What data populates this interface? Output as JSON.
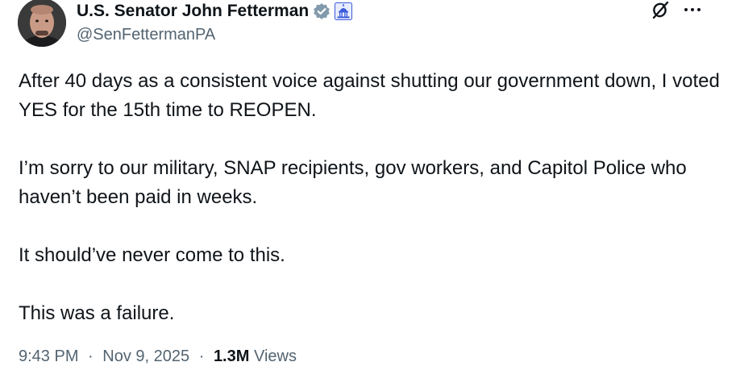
{
  "author": {
    "display_name": "U.S. Senator John Fetterman",
    "handle": "@SenFettermanPA",
    "verified_badge_icon": "verified-badge-icon",
    "government_badge_icon": "capitol-building-icon",
    "badge_color": "#829aab"
  },
  "actions": {
    "grok_icon": "grok-icon",
    "more_icon": "more-options-icon"
  },
  "tweet": {
    "paragraphs": [
      "After 40 days as a consistent voice against shutting our government down, I voted YES for the 15th time to REOPEN.",
      "I’m sorry to our military, SNAP recipients, gov workers, and Capitol Police who haven’t been paid in weeks.",
      "It should’ve never come to this.",
      "This was a failure."
    ]
  },
  "meta": {
    "time": "9:43 PM",
    "separator": "·",
    "date": "Nov 9, 2025",
    "views_count": "1.3M",
    "views_label": "Views"
  },
  "colors": {
    "text_primary": "#0f1419",
    "text_secondary": "#536471",
    "gov_badge_blue": "#3b5bdb"
  }
}
